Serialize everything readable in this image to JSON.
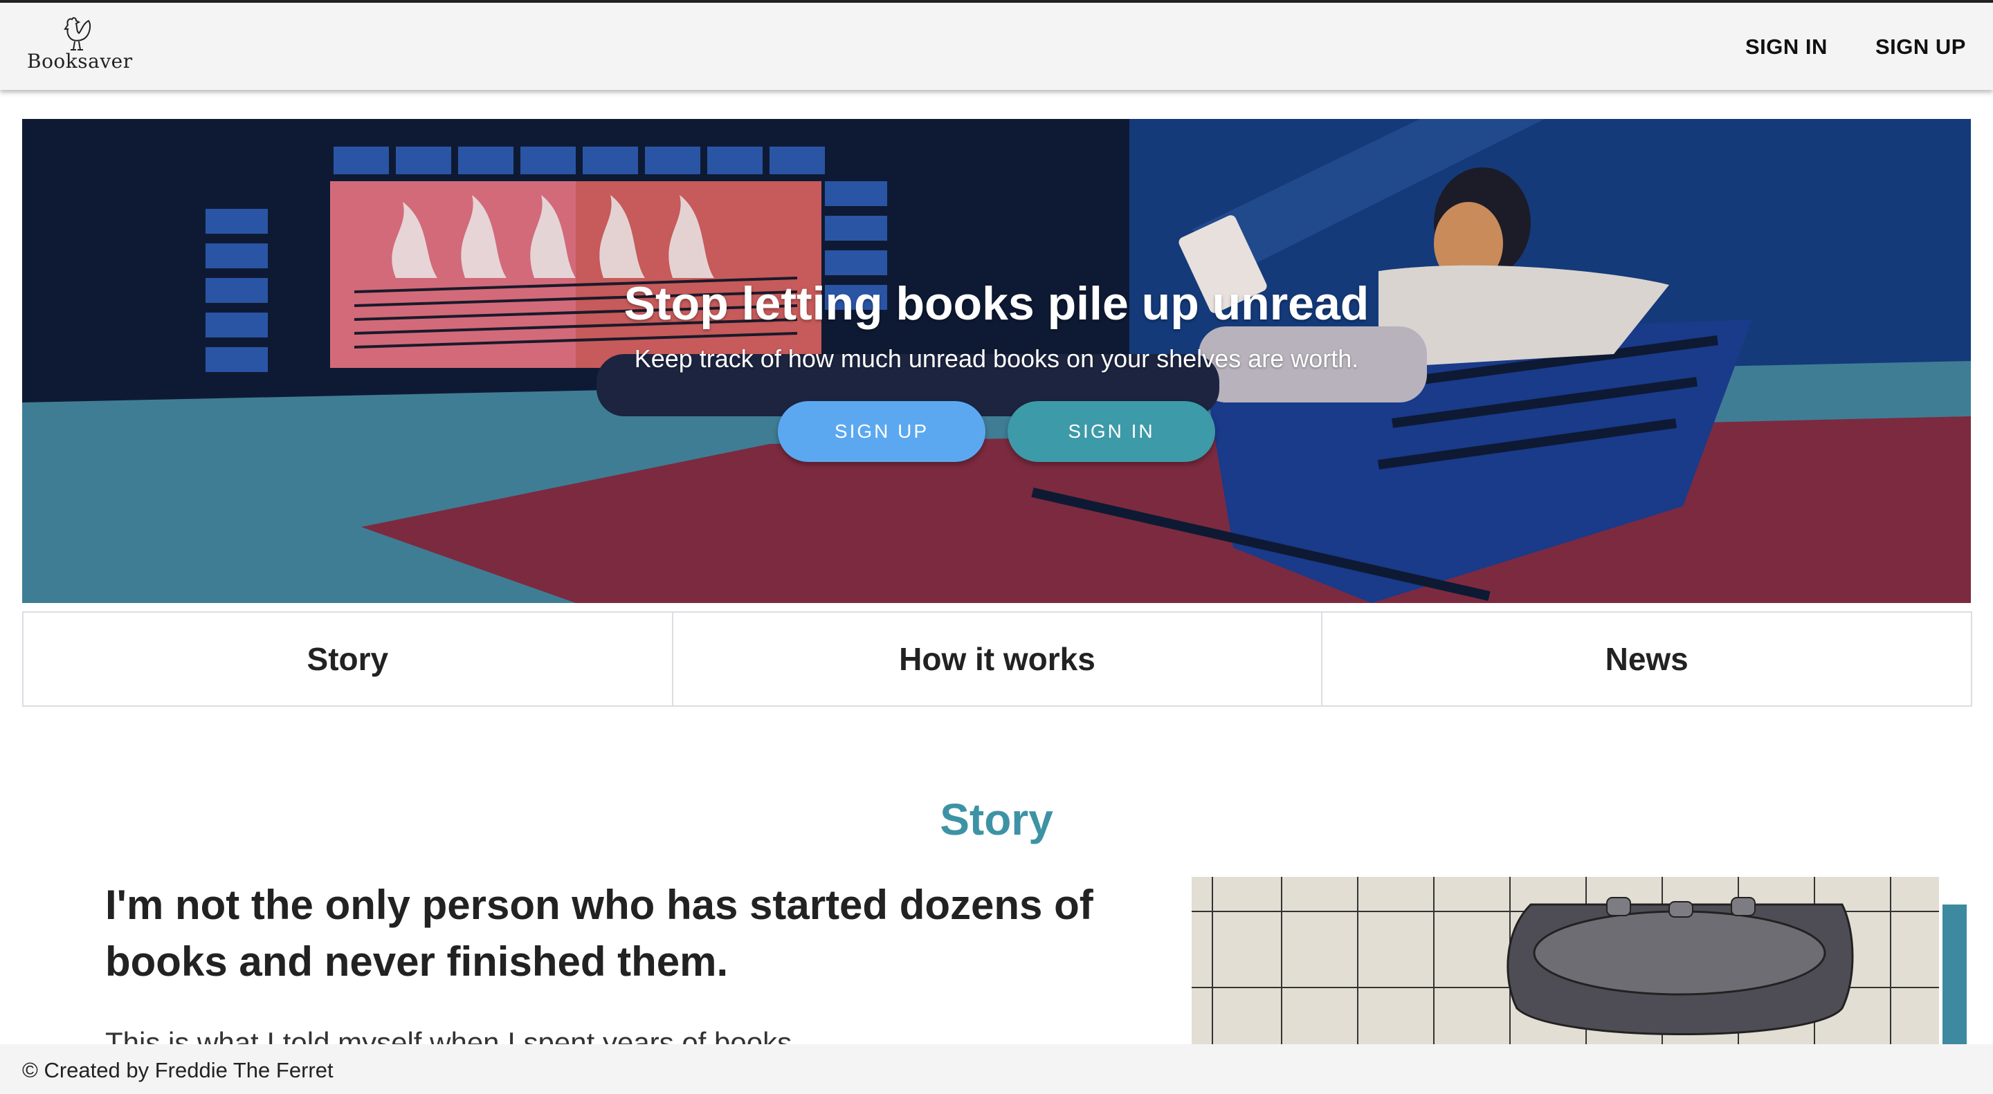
{
  "brand": {
    "name": "Booksaver",
    "logo_icon": "rooster-icon"
  },
  "nav": {
    "sign_in": "SIGN IN",
    "sign_up": "SIGN UP"
  },
  "hero": {
    "title": "Stop letting books pile up unread",
    "subtitle": "Keep track of how much unread books on your shelves are worth.",
    "sign_up": "SIGN UP",
    "sign_in": "SIGN IN"
  },
  "tabs": [
    {
      "label": "Story"
    },
    {
      "label": "How it works"
    },
    {
      "label": "News"
    }
  ],
  "story": {
    "section_title": "Story",
    "heading": "I'm not the only person who has started dozens of books and never finished them.",
    "paragraph": "This is what I told myself when I spent years of books"
  },
  "footer": {
    "text": "© Created by Freddie The Ferret"
  },
  "colors": {
    "accent": "#3d93a5",
    "signup_button": "#5ba8f0",
    "signin_button": "#3d9aa8",
    "navbar_bg": "#f4f4f4"
  }
}
